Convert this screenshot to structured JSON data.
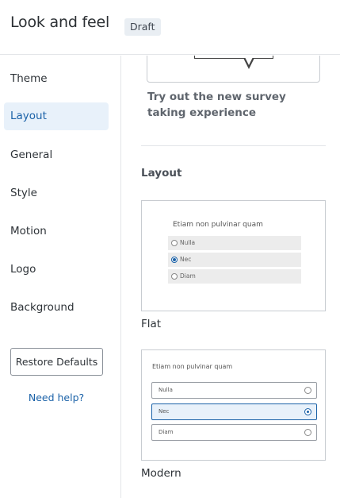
{
  "header": {
    "title": "Look and feel",
    "badge": "Draft"
  },
  "sidebar": {
    "items": [
      {
        "label": "Theme",
        "active": false
      },
      {
        "label": "Layout",
        "active": true
      },
      {
        "label": "General",
        "active": false
      },
      {
        "label": "Style",
        "active": false
      },
      {
        "label": "Motion",
        "active": false
      },
      {
        "label": "Logo",
        "active": false
      },
      {
        "label": "Background",
        "active": false
      }
    ],
    "restore_label": "Restore Defaults",
    "help_label": "Need help?"
  },
  "main": {
    "try_text": "Try out the new survey taking experience",
    "section_title": "Layout",
    "options": [
      {
        "label": "Flat",
        "question": "Etiam non pulvinar quam",
        "choices": [
          "Nulla",
          "Nec",
          "Diam"
        ],
        "selected_index": 1
      },
      {
        "label": "Modern",
        "question": "Etiam non pulvinar quam",
        "choices": [
          "Nulla",
          "Nec",
          "Diam"
        ],
        "selected_index": 1
      }
    ]
  },
  "colors": {
    "accent": "#1b62a8",
    "active_bg": "#e8f1fa"
  }
}
